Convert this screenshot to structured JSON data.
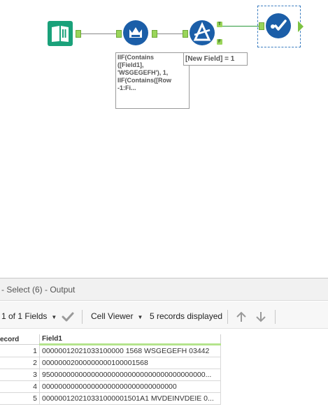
{
  "canvas": {
    "annotations": {
      "formula": "IIF(Contains\n([Field1],\n'WSGEGEFH'), 1,\nIIF(Contains([Row\n-1:Fi...",
      "filter": "[New Field] = 1"
    },
    "filter_badges": {
      "true": "T",
      "false": "F"
    },
    "colors": {
      "input_tool": "#1aa17a",
      "formula_tool": "#1b5ea8",
      "filter_tool": "#1b5ea8",
      "select_tool": "#1b5ea8",
      "anchor": "#7dc242",
      "connection": "#888888",
      "true_connection": "#2a9a3a"
    }
  },
  "results": {
    "title": "- Select (6) - Output",
    "toolbar": {
      "fields": "1 of 1 Fields",
      "viewer": "Cell Viewer",
      "records_displayed": "5 records displayed"
    },
    "columns": {
      "record": "ecord",
      "field1": "Field1"
    },
    "rows": [
      {
        "record": "1",
        "value": "00000012021033100000 1568 WSGEGEFH 03442"
      },
      {
        "record": "2",
        "value": "00000002000000000100001568"
      },
      {
        "record": "3",
        "value": "9500000000000000000000000000000000000000..."
      },
      {
        "record": "4",
        "value": "000000000000000000000000000000000"
      },
      {
        "record": "5",
        "value": "000000120210331000001501A1  MVDEINVDEIE  0..."
      }
    ]
  }
}
